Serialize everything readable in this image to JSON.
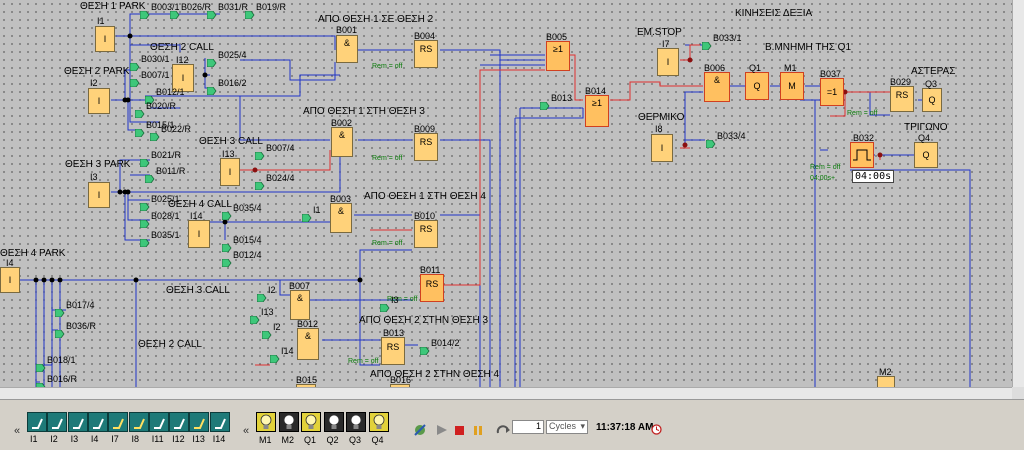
{
  "headings": {
    "right_moves": "ΚΙΝΗΣΕΙΣ ΔΕΞΙΑ",
    "emstop": "ΕΜ.STOP",
    "memory": "Β.ΜΝΗΜΗ ΤΗΣ Q1",
    "thermal": "ΘΕΡΜΙΚΟ",
    "star": "ΑΣΤΕΡΑΣ",
    "triangle": "ΤΡΙΓΩΝΟ",
    "pos1_park": "ΘΕΣΗ 1 PARK",
    "pos2_call": "ΘΕΣΗ 2 CALL",
    "pos2_park": "ΘΕΣΗ 2 PARK",
    "pos3_call": "ΘΕΣΗ 3 CALL",
    "pos3_park": "ΘΕΣΗ 3 PARK",
    "pos4_call": "ΘΕΣΗ 4 CALL",
    "pos4_park": "ΘΕΣΗ 4 PARK",
    "pos3_call_b": "ΘΕΣΗ 3 CALL",
    "pos2_call_b": "ΘΕΣΗ 2 CALL",
    "from1to2": "ΑΠΟ ΘΕΣΗ 1 ΣΕ ΘΕΣΗ 2",
    "from1to3": "ΑΠΟ ΘΕΣΗ 1 ΣΤΗ ΘΕΣΗ 3",
    "from1to4": "ΑΠΟ ΘΕΣΗ 1 ΣΤΗ ΘΕΣΗ 4",
    "from2to3": "ΑΠΟ ΘΕΣΗ 2 ΣΤΗΝ ΘΕΣΗ 3",
    "from2to4": "ΑΠΟ ΘΕΣΗ 2 ΣΤΗΝ ΘΕΣΗ 4"
  },
  "blocks": {
    "I1": {
      "name": "I1",
      "sym": "I"
    },
    "I2": {
      "name": "I2",
      "sym": "I"
    },
    "I3": {
      "name": "I3",
      "sym": "I"
    },
    "I4": {
      "name": "I4",
      "sym": "I"
    },
    "I7": {
      "name": "I7",
      "sym": "I"
    },
    "I8": {
      "name": "I8",
      "sym": "I"
    },
    "I12": {
      "name": "I12",
      "sym": "I"
    },
    "I13": {
      "name": "I13",
      "sym": "I"
    },
    "I14": {
      "name": "I14",
      "sym": "I"
    },
    "B001": {
      "name": "B001",
      "sym": "&"
    },
    "B002": {
      "name": "B002",
      "sym": "&"
    },
    "B003": {
      "name": "B003",
      "sym": "&"
    },
    "B007": {
      "name": "B007",
      "sym": "&"
    },
    "B012": {
      "name": "B012",
      "sym": "&"
    },
    "B004": {
      "name": "B004",
      "sym": "RS"
    },
    "B009": {
      "name": "B009",
      "sym": "RS"
    },
    "B010": {
      "name": "B010",
      "sym": "RS"
    },
    "B011": {
      "name": "B011",
      "sym": "RS"
    },
    "B013b": {
      "name": "B013",
      "sym": "RS"
    },
    "B005": {
      "name": "B005",
      "sym": "≥1"
    },
    "B014": {
      "name": "B014",
      "sym": "≥1"
    },
    "B006": {
      "name": "B006",
      "sym": "&"
    },
    "Q1": {
      "name": "Q1",
      "sym": "Q"
    },
    "M1": {
      "name": "M1",
      "sym": "M"
    },
    "B037": {
      "name": "B037",
      "sym": "=1"
    },
    "B029": {
      "name": "B029",
      "sym": "RS"
    },
    "Q3": {
      "name": "Q3",
      "sym": "Q"
    },
    "B032": {
      "name": "B032",
      "sym": ""
    },
    "Q4": {
      "name": "Q4",
      "sym": "Q"
    },
    "M2": {
      "name": "M2",
      "sym": ""
    },
    "B015": {
      "name": "B015",
      "sym": ""
    },
    "B016": {
      "name": "B016",
      "sym": ""
    }
  },
  "rem_text": "Rem = off",
  "timer": {
    "display": "04:00s",
    "small": "04:00s+"
  },
  "flags": {
    "f1": "B003/1",
    "f2": "B026/R",
    "f3": "B031/R",
    "f4": "B019/R",
    "f5": "B025/4",
    "f6": "B030/1",
    "f7": "B007/1",
    "f8": "B012/1",
    "f9": "B016/2",
    "f10": "B020/R",
    "f11": "B015/1",
    "f12": "B022/R",
    "f13": "B007/4",
    "f14": "B024/4",
    "f15": "B021/R",
    "f16": "B011/R",
    "f17": "B025/1",
    "f18": "B028/1",
    "f19": "B035/4",
    "f20": "B035/1",
    "f21": "B015/4",
    "f22": "B012/4",
    "f23": "B017/4",
    "f24": "B036/R",
    "f25": "B018/1",
    "f26": "B016/R",
    "f27": "B033/1",
    "f28": "B033/4",
    "f29": "B013",
    "f30": "B014/2",
    "f31": "I1",
    "f32": "I2",
    "f33": "I13",
    "f34": "I2",
    "f35": "I14",
    "f36": "I3"
  },
  "toolbar": {
    "inputs": [
      "I1",
      "I2",
      "I3",
      "I4",
      "I7",
      "I8",
      "I11",
      "I12",
      "I13",
      "I14"
    ],
    "outputs": [
      "M1",
      "M2",
      "Q1",
      "Q2",
      "Q3",
      "Q4"
    ],
    "outputs_on": [
      true,
      false,
      true,
      false,
      false,
      true
    ],
    "cycles_value": "1",
    "cycles_unit": "Cycles",
    "time": "11:37:18 AM",
    "collapse": "«"
  },
  "colors": {
    "wire_blue": "#2035c8",
    "wire_red": "#e03030",
    "block": "#ffd27a",
    "rem_green": "#0a7a0a"
  }
}
